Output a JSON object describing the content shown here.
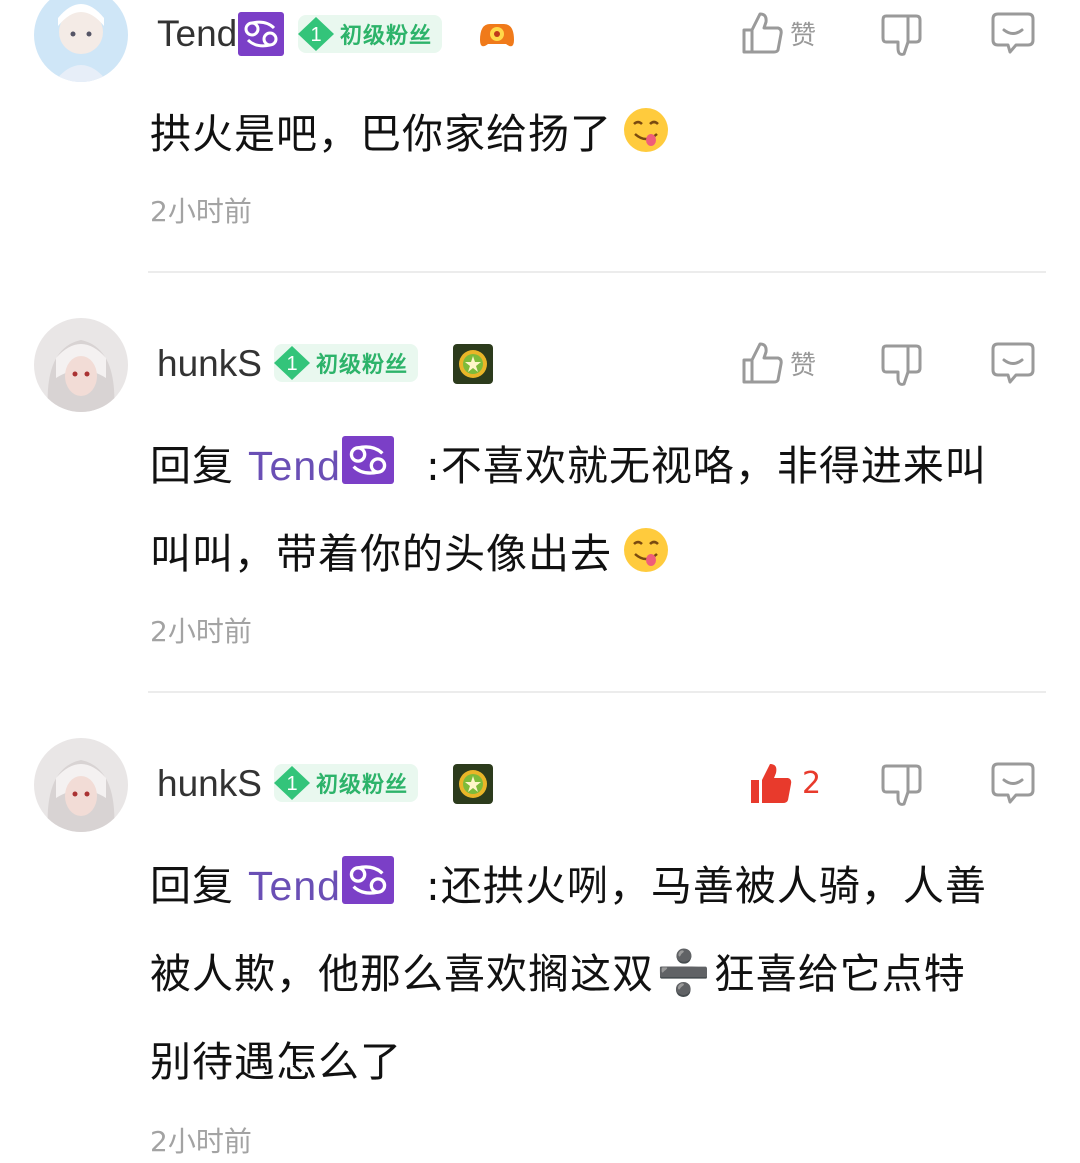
{
  "comments": [
    {
      "username": "Tend",
      "fan_level": "1",
      "fan_label": "初级粉丝",
      "like_label": "赞",
      "text": "拱火是吧，巴你家给扬了",
      "time": "2小时前"
    },
    {
      "username": "hunkS",
      "fan_level": "1",
      "fan_label": "初级粉丝",
      "like_label": "赞",
      "reply_prefix": "回复",
      "reply_to": "Tend",
      "line1": ":不喜欢就无视咯，非得进来叫",
      "line2": "叫叫，带着你的头像出去",
      "time": "2小时前"
    },
    {
      "username": "hunkS",
      "fan_level": "1",
      "fan_label": "初级粉丝",
      "like_count": "2",
      "reply_prefix": "回复",
      "reply_to": "Tend",
      "line1": ":还拱火咧，马善被人骑，人善",
      "line2a": "被人欺，他那么喜欢搁这双",
      "divide_symbol": "➗",
      "line2b": "狂喜给它点特",
      "line3": "别待遇怎么了",
      "time": "2小时前"
    }
  ],
  "colors": {
    "accent_purple": "#6a4fb5",
    "fan_green": "#2db36a",
    "like_red": "#e83a2c",
    "muted": "#a3a3a3"
  }
}
